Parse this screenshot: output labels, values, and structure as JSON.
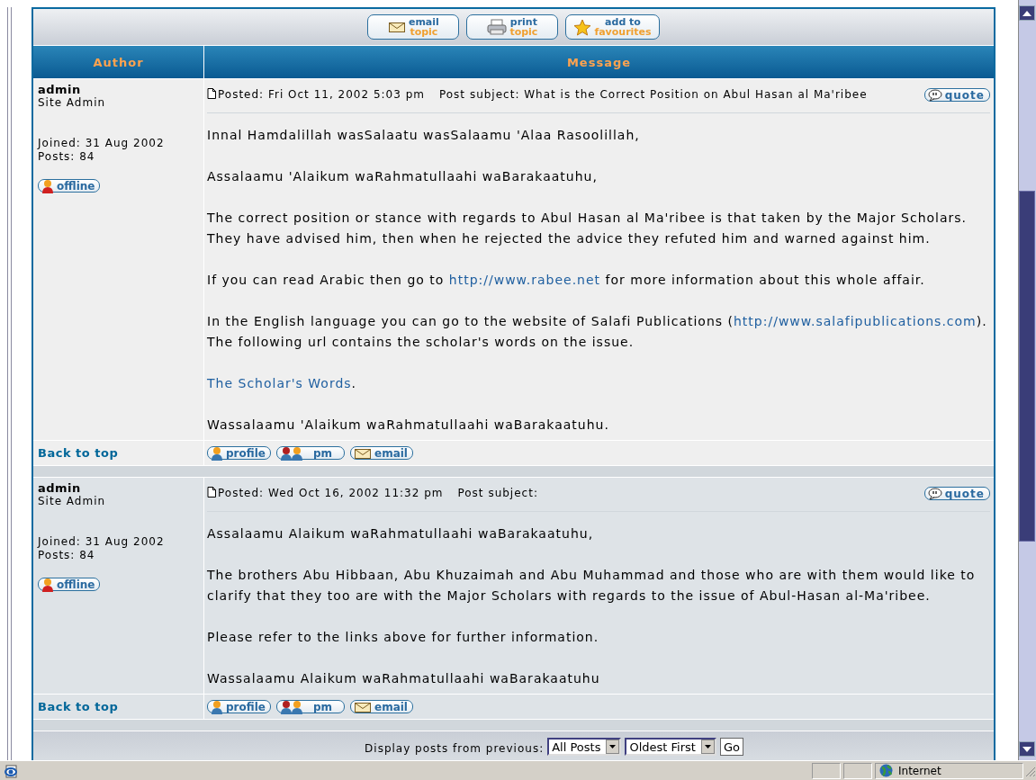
{
  "topic_buttons": [
    {
      "kind": "email",
      "line1": "email",
      "line2": "topic"
    },
    {
      "kind": "print",
      "line1": "print",
      "line2": "topic"
    },
    {
      "kind": "favourite",
      "line1": "add to",
      "line2": "favourites"
    }
  ],
  "columns": [
    "Author",
    "Message"
  ],
  "posts": [
    {
      "author": "admin",
      "rank": "Site Admin",
      "joined": "Joined: 31 Aug 2002",
      "post_count": "Posts: 84",
      "status": "offline",
      "posted": "Posted: Fri Oct 11, 2002 5:03 pm",
      "subject": "Post subject: What is the Correct Position on Abul Hasan al Ma'ribee",
      "quote": "quote",
      "paragraphs": [
        [
          {
            "kind": "text",
            "text": "Innal Hamdalillah wasSalaatu wasSalaamu 'Alaa Rasoolillah,"
          }
        ],
        [
          {
            "kind": "text",
            "text": "Assalaamu 'Alaikum waRahmatullaahi waBarakaatuhu,"
          }
        ],
        [
          {
            "kind": "text",
            "text": "The correct position or stance with regards to Abul Hasan al Ma'ribee is that taken by the Major Scholars.\nThey have advised him, then when he rejected the advice they refuted him and warned against him."
          }
        ],
        [
          {
            "kind": "text",
            "text": "If you can read Arabic then go to "
          },
          {
            "kind": "link",
            "text": "http://www.rabee.net"
          },
          {
            "kind": "text",
            "text": " for more information about this whole affair."
          }
        ],
        [
          {
            "kind": "text",
            "text": "In the English language you can go to the website of Salafi Publications ("
          },
          {
            "kind": "link",
            "text": "http://www.salafipublications.com"
          },
          {
            "kind": "text",
            "text": ").\nThe following url contains the scholar's words on the issue."
          }
        ],
        [
          {
            "kind": "link",
            "text": "The Scholar's Words"
          },
          {
            "kind": "text",
            "text": "."
          }
        ],
        [
          {
            "kind": "text",
            "text": "Wassalaamu 'Alaikum waRahmatullaahi waBarakaatuhu."
          }
        ]
      ],
      "back_to_top": "Back to top",
      "actions": [
        {
          "kind": "profile",
          "label": "profile"
        },
        {
          "kind": "pm",
          "label": "pm"
        },
        {
          "kind": "email",
          "label": "email"
        }
      ]
    },
    {
      "author": "admin",
      "rank": "Site Admin",
      "joined": "Joined: 31 Aug 2002",
      "post_count": "Posts: 84",
      "status": "offline",
      "posted": "Posted: Wed Oct 16, 2002 11:32 pm",
      "subject": "Post subject:",
      "quote": "quote",
      "paragraphs": [
        [
          {
            "kind": "text",
            "text": "Assalaamu Alaikum waRahmatullaahi waBarakaatuhu,"
          }
        ],
        [
          {
            "kind": "text",
            "text": "The brothers Abu Hibbaan, Abu Khuzaimah and Abu Muhammad and those who are with them would like to\nclarify that they too are with the Major Scholars with regards to the issue of Abul-Hasan al-Ma'ribee."
          }
        ],
        [
          {
            "kind": "text",
            "text": "Please refer to the links above for further information."
          }
        ],
        [
          {
            "kind": "text",
            "text": "Wassalaamu Alaikum waRahmatullaahi waBarakaatuhu"
          }
        ]
      ],
      "back_to_top": "Back to top",
      "actions": [
        {
          "kind": "profile",
          "label": "profile"
        },
        {
          "kind": "pm",
          "label": "pm"
        },
        {
          "kind": "email",
          "label": "email"
        }
      ]
    }
  ],
  "display": {
    "label": "Display posts from previous:",
    "selects": [
      "All Posts",
      "Oldest First"
    ],
    "button": "Go"
  },
  "status_bar": {
    "zone": "Internet"
  }
}
